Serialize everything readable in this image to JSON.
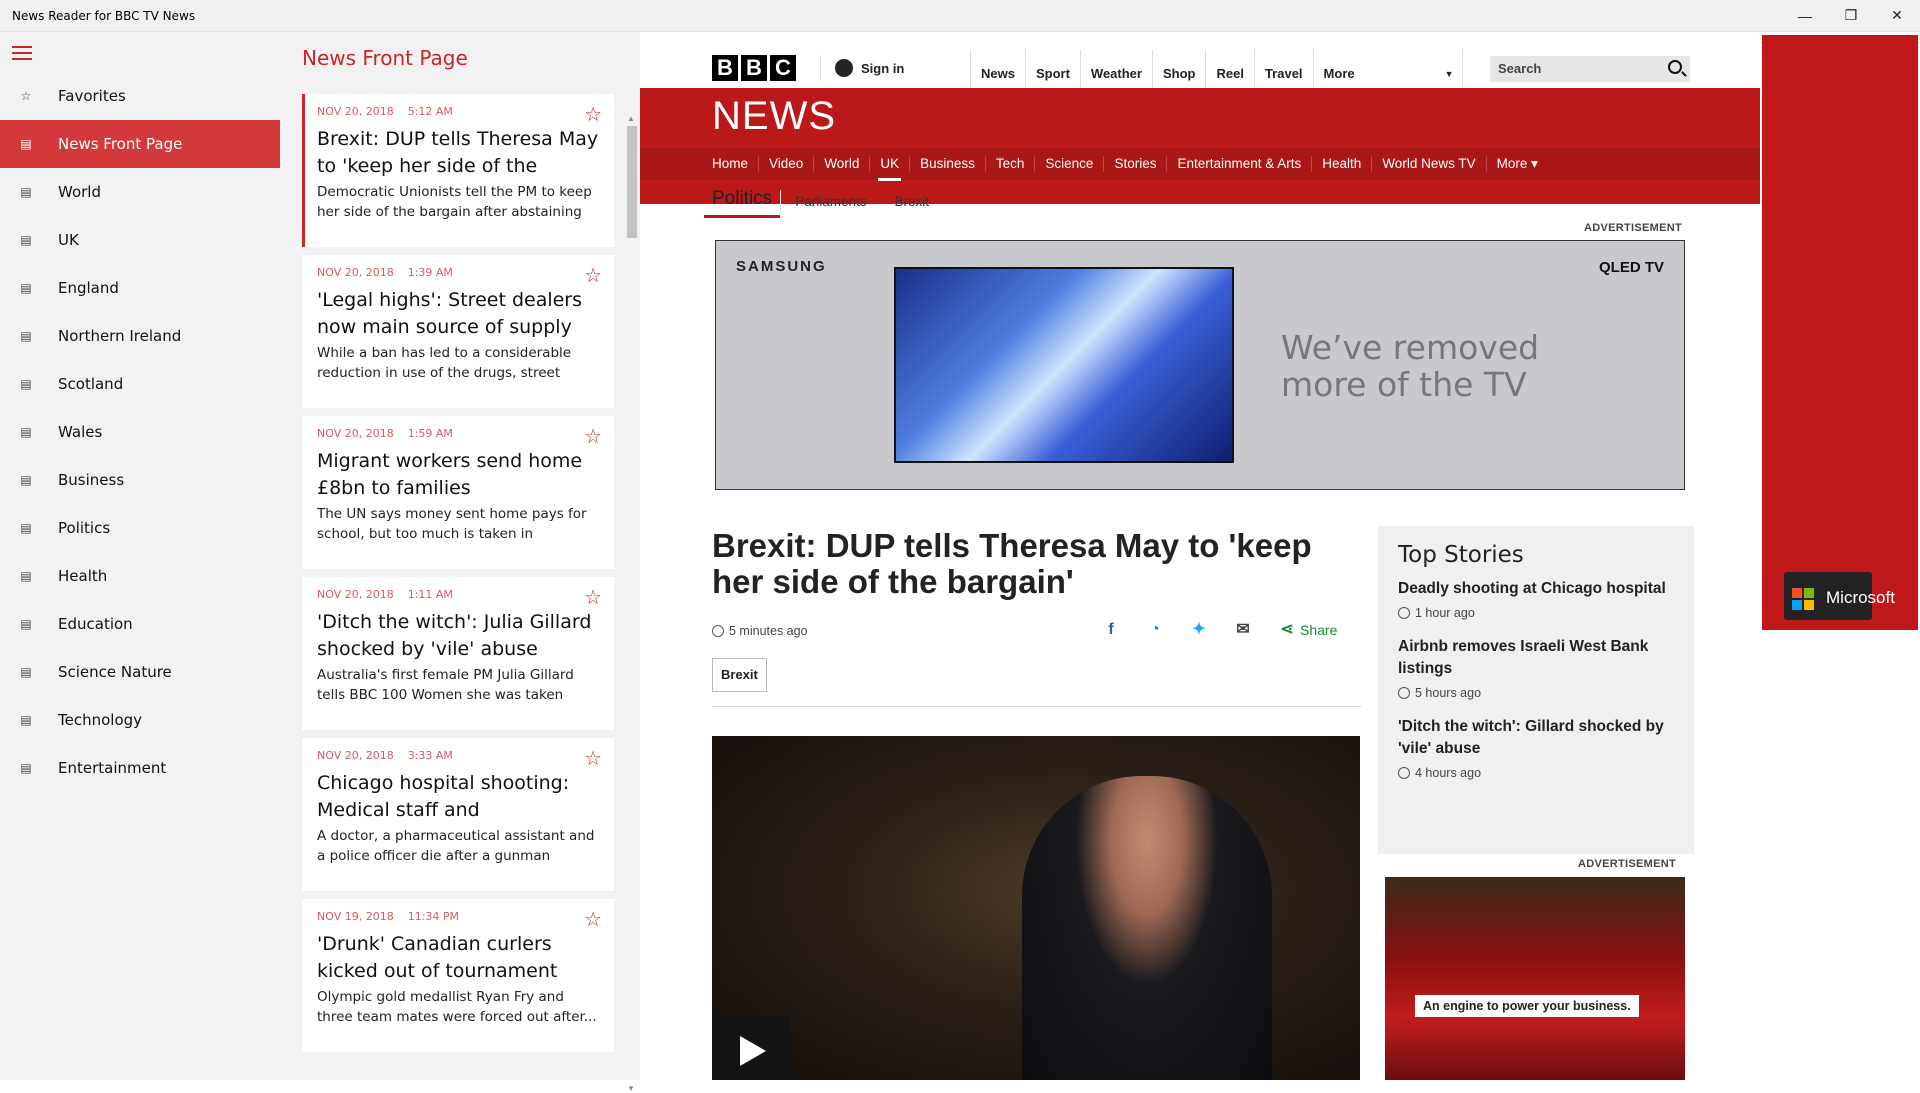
{
  "window": {
    "title": "News Reader for BBC TV News",
    "min": "—",
    "restore": "❐",
    "close": "✕"
  },
  "nav": {
    "items": [
      {
        "label": "Favorites",
        "icon": "☆"
      },
      {
        "label": "News Front Page",
        "icon": "▤"
      },
      {
        "label": "World",
        "icon": "▤"
      },
      {
        "label": "UK",
        "icon": "▤"
      },
      {
        "label": "England",
        "icon": "▤"
      },
      {
        "label": "Northern Ireland",
        "icon": "▤"
      },
      {
        "label": "Scotland",
        "icon": "▤"
      },
      {
        "label": "Wales",
        "icon": "▤"
      },
      {
        "label": "Business",
        "icon": "▤"
      },
      {
        "label": "Politics",
        "icon": "▤"
      },
      {
        "label": "Health",
        "icon": "▤"
      },
      {
        "label": "Education",
        "icon": "▤"
      },
      {
        "label": "Science Nature",
        "icon": "▤"
      },
      {
        "label": "Technology",
        "icon": "▤"
      },
      {
        "label": "Entertainment",
        "icon": "▤"
      }
    ]
  },
  "list": {
    "title": "News Front Page",
    "articles": [
      {
        "date": "NOV 20, 2018",
        "time": "5:12 AM",
        "headline": "Brexit: DUP tells Theresa May to 'keep her side of the bargain'",
        "summary": "Democratic Unionists tell the PM to keep her side of the bargain after abstaining in..."
      },
      {
        "date": "NOV 20, 2018",
        "time": "1:39 AM",
        "headline": "'Legal highs': Street dealers now main source of supply after ban",
        "summary": "While a ban has led to a considerable reduction in use of the drugs, street deale..."
      },
      {
        "date": "NOV 20, 2018",
        "time": "1:59 AM",
        "headline": "Migrant workers send home £8bn to families",
        "summary": "The UN says money sent home pays for school, but too much is taken in transfer..."
      },
      {
        "date": "NOV 20, 2018",
        "time": "1:11 AM",
        "headline": "'Ditch the witch': Julia Gillard shocked by 'vile' abuse while...",
        "summary": "Australia's first female PM Julia Gillard tells BBC 100 Women she was taken aback by..."
      },
      {
        "date": "NOV 20, 2018",
        "time": "3:33 AM",
        "headline": "Chicago hospital shooting: Medical staff and policeman...",
        "summary": "A doctor, a pharmaceutical assistant and a police officer die after a gunman opens..."
      },
      {
        "date": "NOV 19, 2018",
        "time": "11:34 PM",
        "headline": "'Drunk' Canadian curlers kicked out of tournament final",
        "summary": "Olympic gold medallist Ryan Fry and three team mates were forced out after..."
      }
    ]
  },
  "bbc": {
    "logo": [
      "B",
      "B",
      "C"
    ],
    "signin": "Sign in",
    "topnav": [
      "News",
      "Sport",
      "Weather",
      "Shop",
      "Reel",
      "Travel"
    ],
    "more": "More",
    "search_placeholder": "Search",
    "news_word": "NEWS",
    "subnav": [
      "Home",
      "Video",
      "World",
      "UK",
      "Business",
      "Tech",
      "Science",
      "Stories",
      "Entertainment & Arts",
      "Health",
      "World News TV",
      "More ▾"
    ],
    "politics": "Politics",
    "subsub": [
      "Parliaments",
      "Brexit"
    ],
    "advertisement": "ADVERTISEMENT",
    "ad1": {
      "brand": "SAMSUNG",
      "product": "QLED TV",
      "tagline1": "We’ve removed",
      "tagline2": "more of the TV"
    },
    "article": {
      "headline": "Brexit: DUP tells Theresa May to 'keep her side of the bargain'",
      "time_ago": "5 minutes ago",
      "share": "Share",
      "tag": "Brexit"
    },
    "top_stories": {
      "title": "Top Stories",
      "items": [
        {
          "title": "Deadly shooting at Chicago hospital",
          "ago": "1 hour ago"
        },
        {
          "title": "Airbnb removes Israeli West Bank listings",
          "ago": "5 hours ago"
        },
        {
          "title": "'Ditch the witch': Gillard shocked by 'vile' abuse",
          "ago": "4 hours ago"
        }
      ]
    },
    "ad2_text": "An engine to power your business.",
    "side_ad": "Microsoft"
  }
}
